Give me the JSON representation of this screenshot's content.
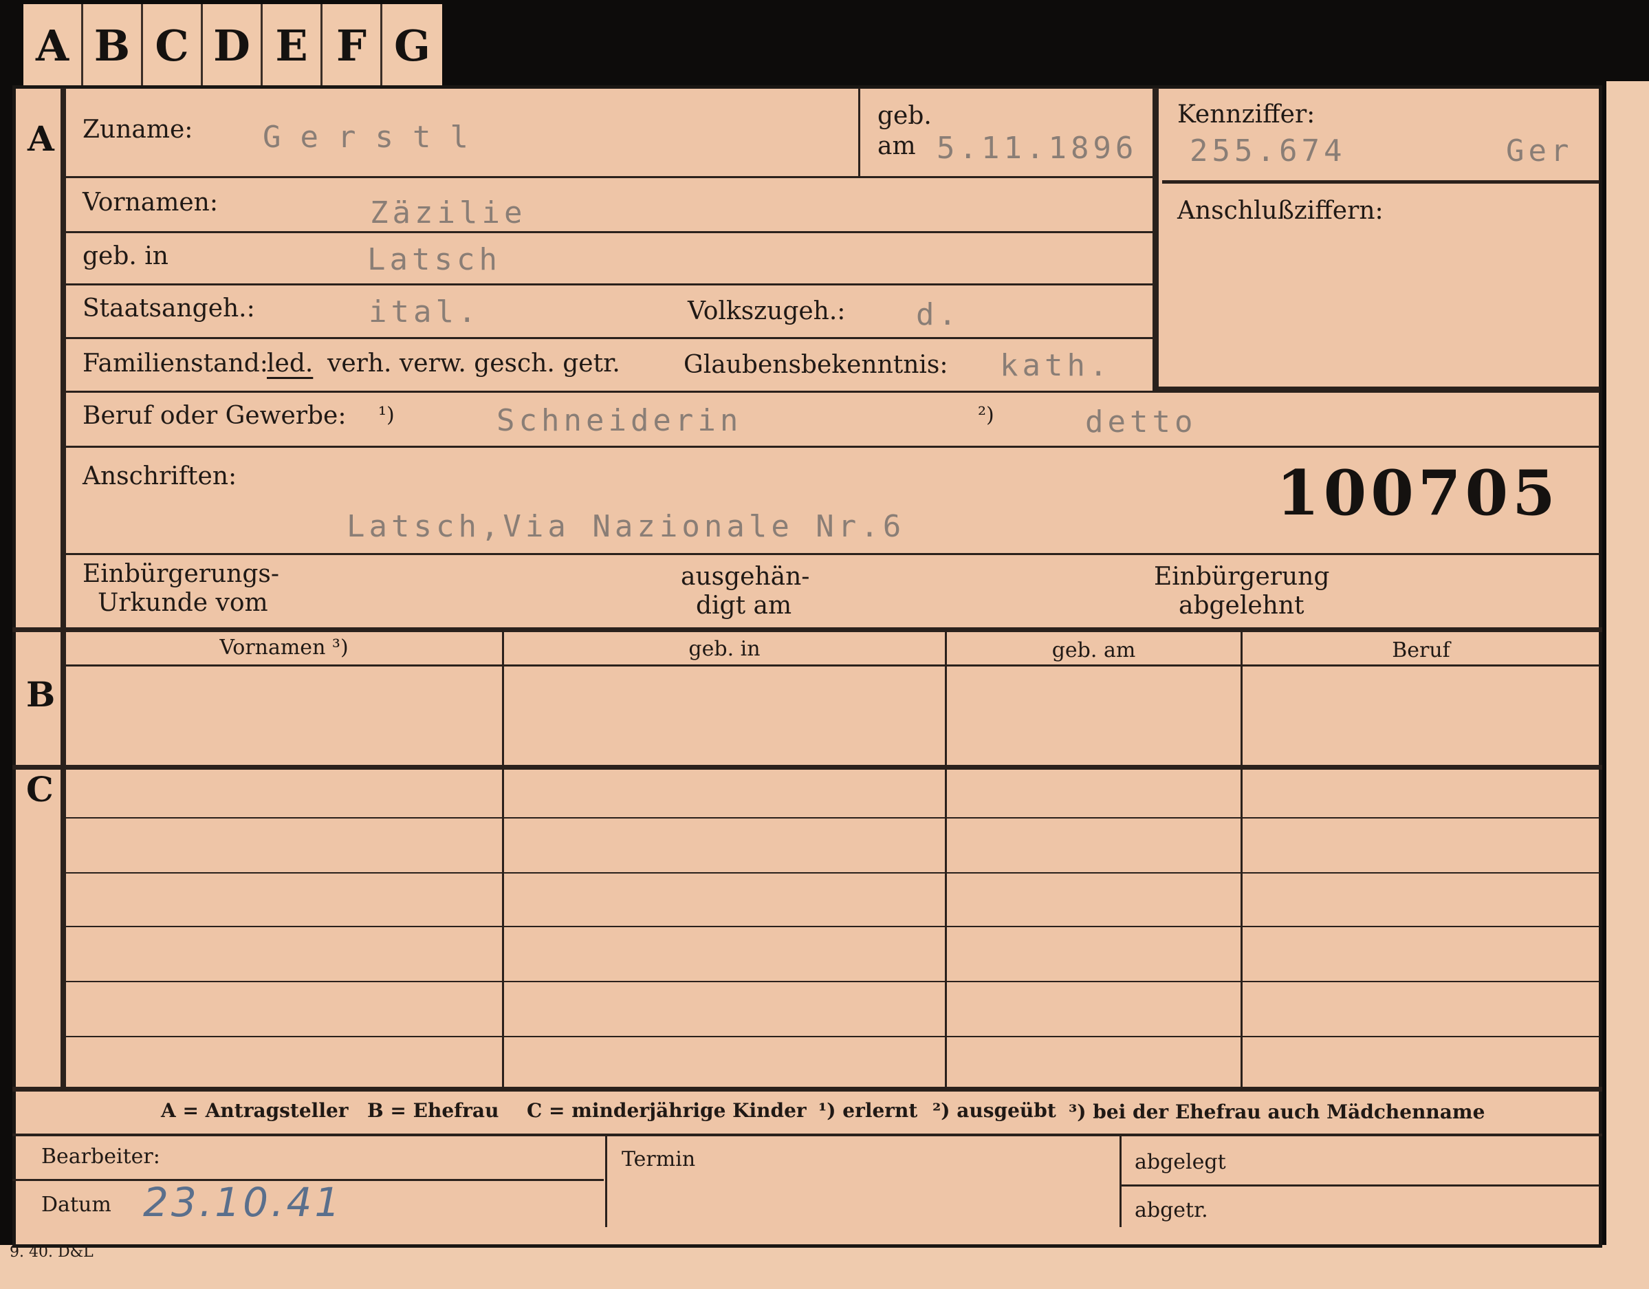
{
  "tabs": [
    "A",
    "B",
    "C",
    "D",
    "E",
    "F",
    "G"
  ],
  "sections": {
    "a": "A",
    "b": "B",
    "c": "C"
  },
  "fields": {
    "zuname_label": "Zuname:",
    "zuname_value": "Gerstl",
    "geb_label": "geb.",
    "am_label": "am",
    "geb_am_value": "5.11.1896",
    "kennziffer_label": "Kennziffer:",
    "kennziffer_value": "255.674",
    "kennziffer_suffix": "Ger",
    "anschluss_label": "Anschlußziffern:",
    "vornamen_label": "Vornamen:",
    "vornamen_value": "Zäzilie",
    "gebin_label": "geb. in",
    "gebin_value": "Latsch",
    "staat_label": "Staatsangeh.:",
    "staat_value": "ital.",
    "volk_label": "Volkszugeh.:",
    "volk_value": "d.",
    "familienstand_label": "Familienstand:",
    "familienstand_options": {
      "leb": "led.",
      "rest": "verh. verw. gesch. getr."
    },
    "glauben_label": "Glaubensbekenntnis:",
    "glauben_value": "kath.",
    "beruf_label": "Beruf oder Gewerbe:",
    "beruf_1_marker": "¹)",
    "beruf_1_value": "Schneiderin",
    "beruf_2_marker": "²)",
    "beruf_2_value": "detto",
    "anschriften_label": "Anschriften:",
    "anschriften_value": "Latsch,Via Nazionale Nr.6",
    "stamp_number": "100705",
    "einb_urkunde_line1": "Einbürgerungs-",
    "einb_urkunde_line2": "Urkunde vom",
    "ausgehaendigt_line1": "ausgehän-",
    "ausgehaendigt_line2": "digt am",
    "einb_abgelehnt_line1": "Einbürgerung",
    "einb_abgelehnt_line2": "abgelehnt"
  },
  "table": {
    "headers": [
      "Vornamen ³)",
      "geb. in",
      "geb. am",
      "Beruf"
    ]
  },
  "legend": {
    "a": "A = Antragsteller",
    "b": "B = Ehefrau",
    "c": "C = minderjährige Kinder",
    "n1": "¹) erlernt",
    "n2": "²) ausgeübt",
    "n3": "³) bei der Ehefrau auch Mädchenname"
  },
  "footer": {
    "bearbeiter_label": "Bearbeiter:",
    "datum_label": "Datum",
    "datum_value": "23.10.41",
    "termin_label": "Termin",
    "abgelegt_label": "abgelegt",
    "abgetr_label": "abgetr."
  },
  "print_code": "9. 40. D&L"
}
